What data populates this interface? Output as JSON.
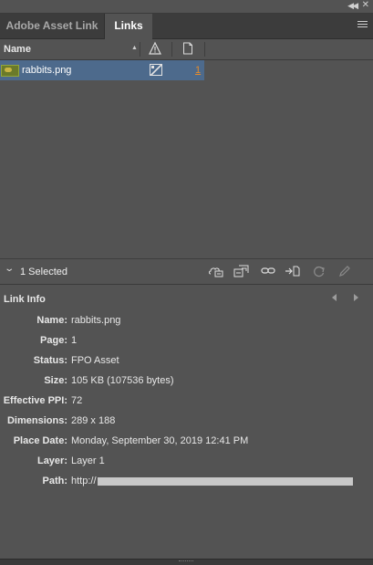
{
  "tabs": [
    {
      "label": "Adobe Asset Link",
      "active": false
    },
    {
      "label": "Links",
      "active": true
    }
  ],
  "columns": {
    "name_label": "Name",
    "status_icon": "warning-triangle-icon",
    "page_icon": "page-icon"
  },
  "links": [
    {
      "name": "rabbits.png",
      "status_icon": "fpo-status-icon",
      "page": "1",
      "selected": true
    }
  ],
  "toolbar": {
    "selection_text": "1 Selected",
    "icons": [
      "cloud-relink-icon",
      "relink-to-folder-icon",
      "go-to-link-icon",
      "update-link-icon",
      "refresh-icon",
      "edit-original-icon"
    ]
  },
  "link_info": {
    "title": "Link Info",
    "fields": [
      {
        "label": "Name:",
        "value": "rabbits.png"
      },
      {
        "label": "Page:",
        "value": "1"
      },
      {
        "label": "Status:",
        "value": "FPO Asset"
      },
      {
        "label": "Size:",
        "value": "105 KB (107536 bytes)"
      },
      {
        "label": "Effective PPI:",
        "value": "72"
      },
      {
        "label": "Dimensions:",
        "value": "289 x 188"
      },
      {
        "label": "Place Date:",
        "value": "Monday, September 30, 2019 12:41 PM"
      },
      {
        "label": "Layer:",
        "value": "Layer 1"
      },
      {
        "label": "Path:",
        "value": "http://"
      }
    ]
  },
  "colors": {
    "panel_bg": "#535353",
    "tab_bar_bg": "#3c3c3c",
    "selected_row": "#4d6a8c",
    "page_link": "#e48b2c"
  }
}
